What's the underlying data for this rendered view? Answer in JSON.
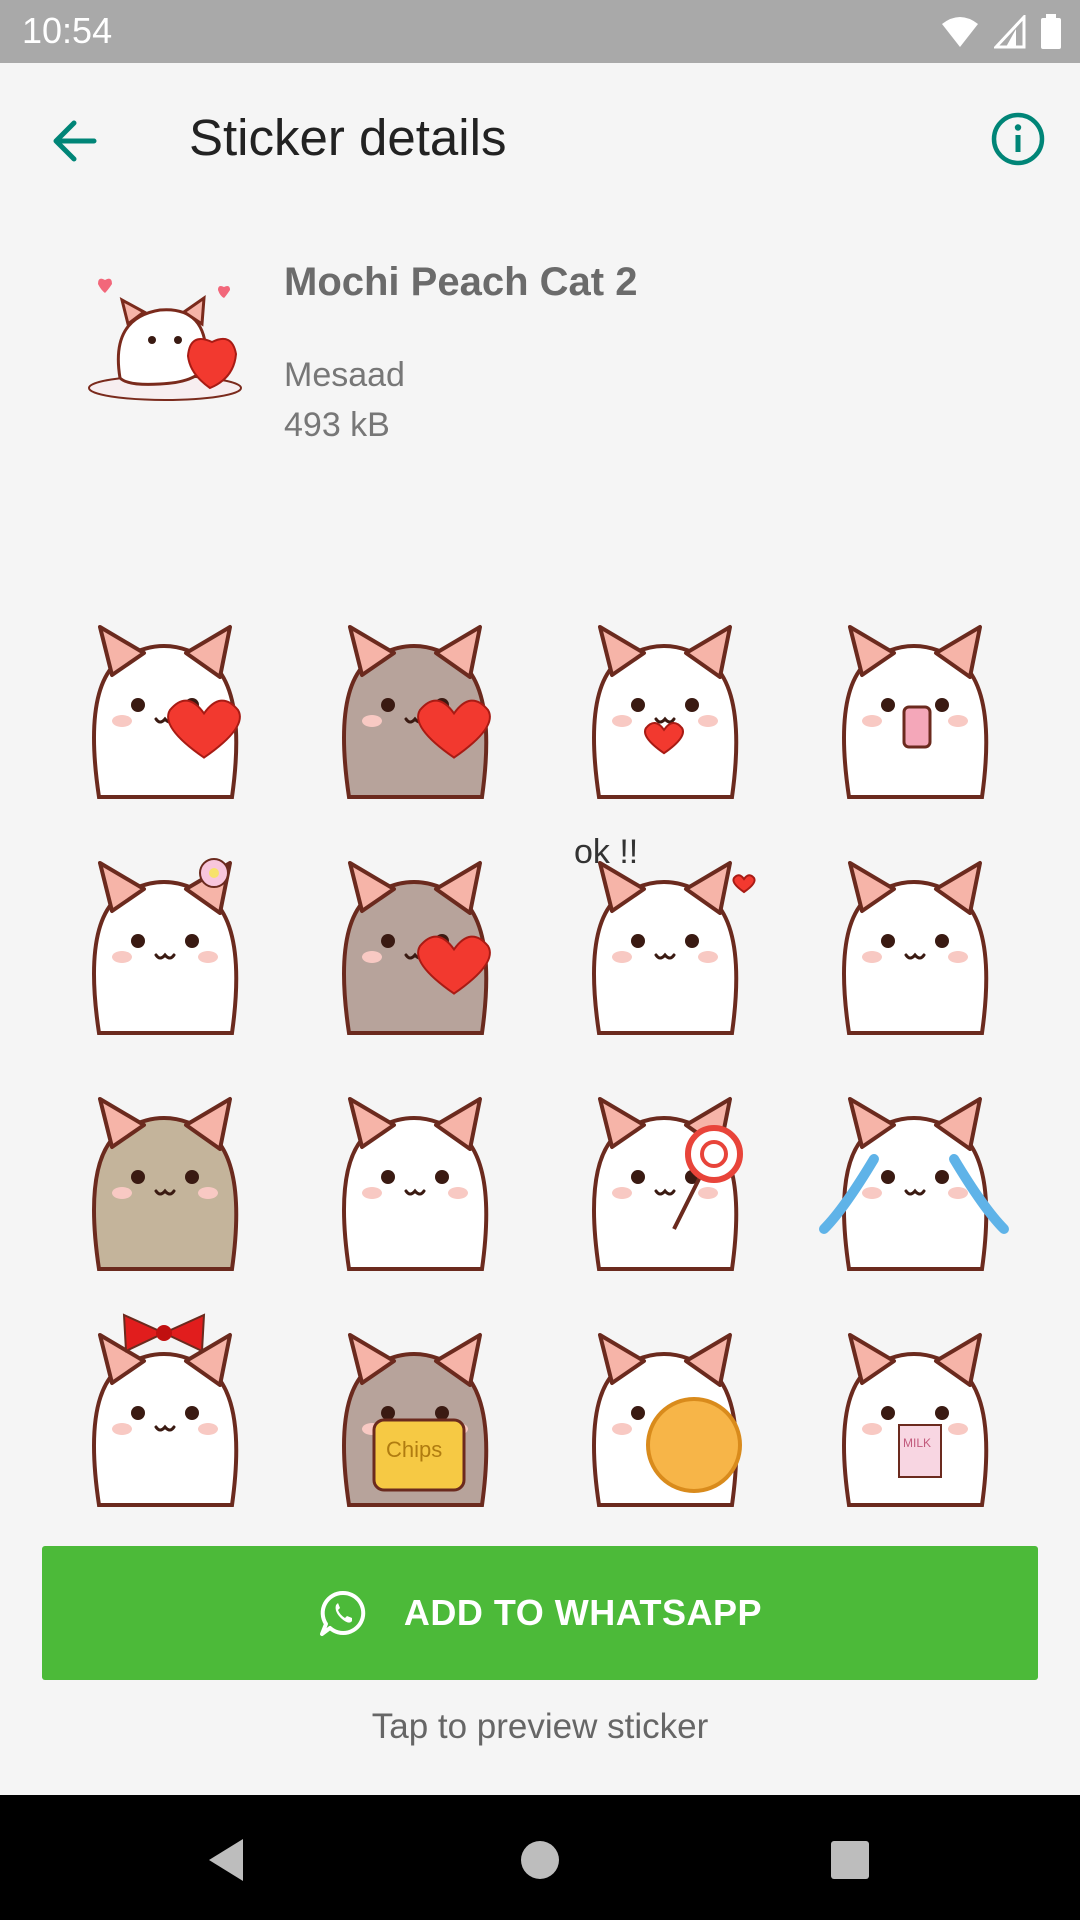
{
  "status_bar": {
    "time": "10:54"
  },
  "app_bar": {
    "title": "Sticker details"
  },
  "pack": {
    "name": "Mochi Peach Cat 2",
    "publisher": "Mesaad",
    "size": "493 kB"
  },
  "stickers": [
    {
      "cat": "white",
      "prop": "heart",
      "text": ""
    },
    {
      "cat": "gray",
      "prop": "heart",
      "text": ""
    },
    {
      "cat": "white",
      "prop": "heart-small",
      "text": ""
    },
    {
      "cat": "white",
      "prop": "phone",
      "text": ""
    },
    {
      "cat": "white",
      "prop": "flower",
      "text": ""
    },
    {
      "cat": "gray",
      "prop": "heart",
      "text": ""
    },
    {
      "cat": "white",
      "prop": "ok",
      "text": "ok !!"
    },
    {
      "cat": "white",
      "prop": "none",
      "text": ""
    },
    {
      "cat": "tan",
      "prop": "none",
      "text": ""
    },
    {
      "cat": "white",
      "prop": "none",
      "text": ""
    },
    {
      "cat": "white",
      "prop": "lollipop",
      "text": ""
    },
    {
      "cat": "white",
      "prop": "tears",
      "text": ""
    },
    {
      "cat": "white",
      "prop": "bow",
      "text": ""
    },
    {
      "cat": "gray",
      "prop": "chips",
      "text": "Chips"
    },
    {
      "cat": "white",
      "prop": "cookie",
      "text": ""
    },
    {
      "cat": "white",
      "prop": "milk",
      "text": "MILK"
    },
    {
      "cat": "white",
      "prop": "none",
      "text": ""
    },
    {
      "cat": "gray",
      "prop": "none",
      "text": ""
    },
    {
      "cat": "white",
      "prop": "none",
      "text": ""
    },
    {
      "cat": "white",
      "prop": "none",
      "text": ""
    }
  ],
  "add_button": {
    "label": "ADD TO WHATSAPP",
    "icon": "whatsapp-icon"
  },
  "hint": "Tap to preview sticker",
  "colors": {
    "accent": "#008577",
    "button_green": "#4cba39",
    "status_bar": "#a9a9a9",
    "heart_red": "#f2392f"
  },
  "icons": {
    "back": "arrow-left-icon",
    "info": "info-icon",
    "nav_back": "triangle-back-icon",
    "nav_home": "circle-home-icon",
    "nav_recents": "square-recents-icon"
  }
}
